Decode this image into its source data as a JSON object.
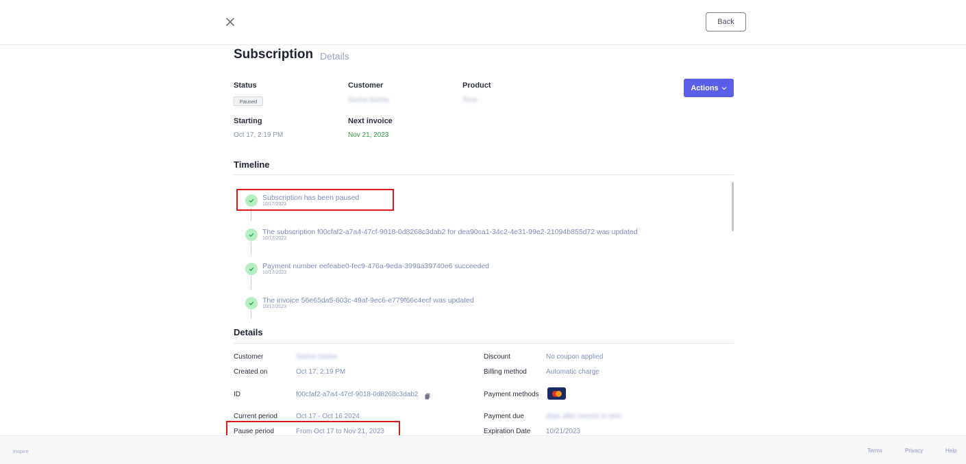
{
  "header": {
    "back_label": "Back"
  },
  "page": {
    "title": "Subscription",
    "subtitle": "Details"
  },
  "summary": {
    "status_label": "Status",
    "status_value": "Paused",
    "customer_label": "Customer",
    "customer_value": "Sasha Sasha",
    "product_label": "Product",
    "product_value": "Tone",
    "starting_label": "Starting",
    "starting_value": "Oct 17, 2:19 PM",
    "next_invoice_label": "Next invoice",
    "next_invoice_value": "Nov 21, 2023",
    "actions_label": "Actions"
  },
  "timeline": {
    "title": "Timeline",
    "events": [
      {
        "title": "Subscription has been paused",
        "date": "10/17/2023"
      },
      {
        "title": "The subscription f00cfaf2-a7a4-47cf-9018-0d8268c3dab2 for dea90ca1-34c2-4e31-99e2-21094b855d72 was updated",
        "date": "10/17/2023"
      },
      {
        "title": "Payment number eefeabe0-fec9-476a-9eda-3998a39740e6 succeeded",
        "date": "10/17/2023"
      },
      {
        "title": "The invoice 56e65da5-603c-49af-9ec6-e779f66c4ecf was updated",
        "date": "10/17/2023"
      }
    ]
  },
  "details": {
    "title": "Details",
    "customer_label": "Customer",
    "customer_value": "Sasha Sasha",
    "created_label": "Created on",
    "created_value": "Oct 17, 2:19 PM",
    "id_label": "ID",
    "id_value": "f00cfaf2-a7a4-47cf-9018-0d8268c3dab2",
    "current_period_label": "Current period",
    "current_period_value": "Oct 17 - Oct 16 2024",
    "pause_period_label": "Pause period",
    "pause_period_value": "From Oct 17 to Nov 21, 2023",
    "discount_label": "Discount",
    "discount_value": "No coupon applied",
    "billing_label": "Billing method",
    "billing_value": "Automatic charge",
    "payment_methods_label": "Payment methods",
    "payment_due_label": "Payment due",
    "payment_due_value": "days after invoice is sent",
    "expiration_label": "Expiration Date",
    "expiration_value": "10/21/2023"
  },
  "footer": {
    "brand": "Inspire",
    "terms": "Terms",
    "privacy": "Privacy",
    "help": "Help"
  },
  "colors": {
    "accent": "#5b5ee8",
    "highlight": "#e0141b",
    "success": "#2e9a3a"
  }
}
